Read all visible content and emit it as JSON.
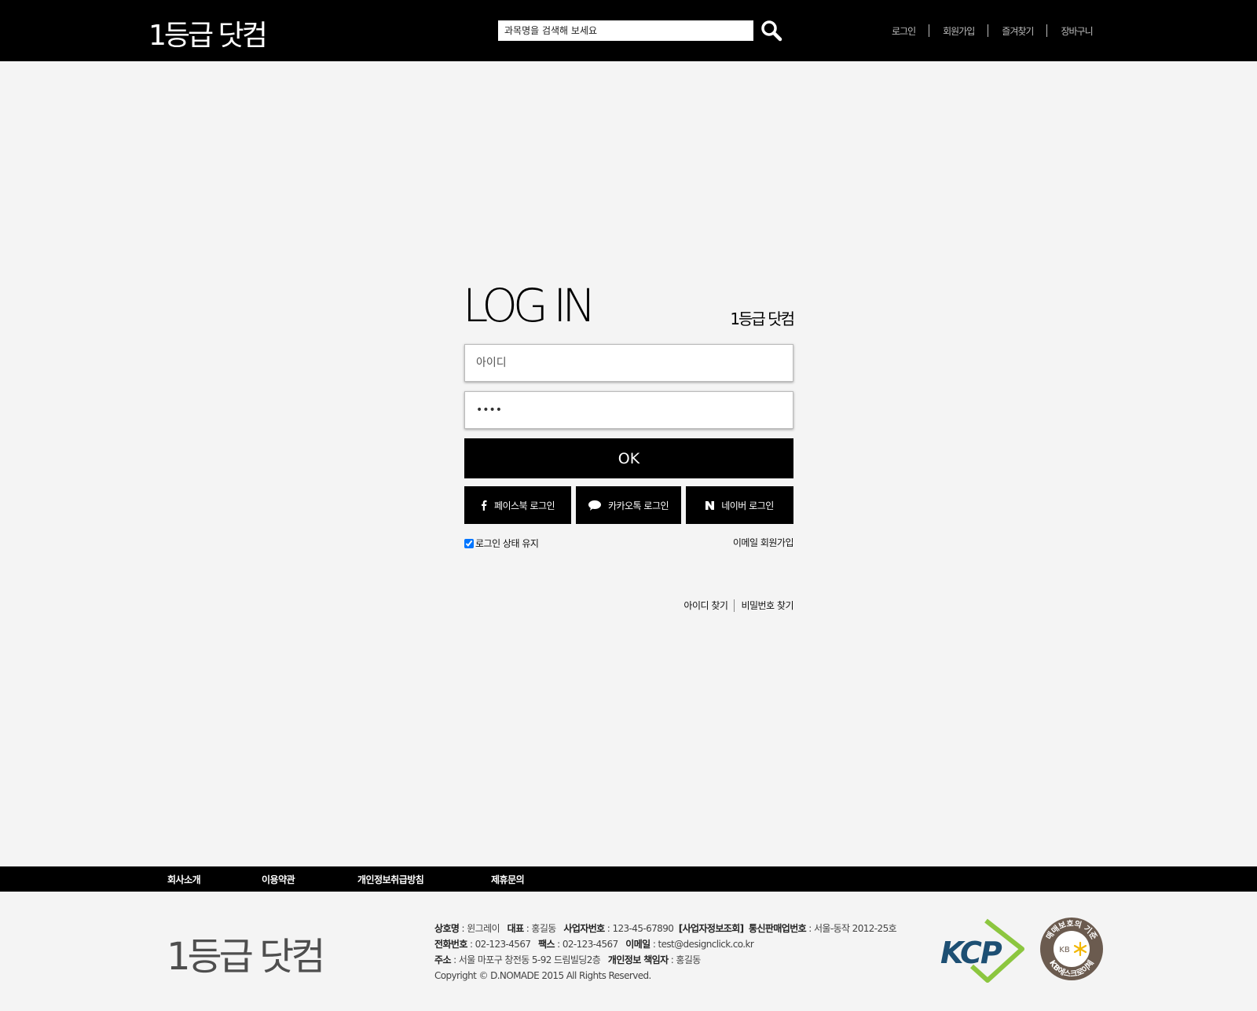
{
  "header": {
    "logo": "1등급 닷컴",
    "search_placeholder": "과목명을 검색해 보세요",
    "nav": [
      "로그인",
      "회원가입",
      "즐겨찾기",
      "장바구니"
    ]
  },
  "login": {
    "title": "LOG IN",
    "brand": "1등급 닷컴",
    "id_placeholder": "아이디",
    "pw_value": "••••",
    "ok_label": "OK",
    "facebook_label": "페이스북 로그인",
    "kakao_label": "카카오톡 로그인",
    "naver_label": "네이버 로그인",
    "keep_label": "로그인 상태 유지",
    "email_join": "이메일 회원가입",
    "find_id": "아이디 찾기",
    "find_pw": "비밀번호 찾기"
  },
  "footer": {
    "nav": [
      "회사소개",
      "이용약관",
      "개인정보취급방침",
      "제휴문의"
    ],
    "logo": "1등급 닷컴",
    "company_label": "상호명",
    "company": " : 윈그레이",
    "ceo_label": "대표",
    "ceo": " : 홍길동",
    "bizno_label": "사업자번호",
    "bizno": " : 123-45-67890",
    "bizinfo_label": "[사업자정보조회]",
    "mailorder_label": "통신판매업번호",
    "mailorder": " : 서울-동작 2012-25호",
    "phone_label": "전화번호",
    "phone": " : 02-123-4567",
    "fax_label": "팩스",
    "fax": " : 02-123-4567",
    "email_label": "이메일",
    "email": " : test@designclick.co.kr",
    "addr_label": "주소",
    "addr": " : 서울 마포구 창전동 5-92 드림빌딩2층",
    "privacy_label": "개인정보 책임자",
    "privacy": " : 홍길동",
    "copyright": "Copyright © D.NOMADE 2015 All Rights Reserved.",
    "kcp_text": "KCP",
    "kb_ring_top": "매매보호의 기준",
    "kb_ring_bottom": "KB에스크로이체",
    "kb_center": "KB"
  },
  "colors": {
    "header_bg": "#000000",
    "page_bg": "#f4f4f4",
    "kcp_blue": "#1d4f73",
    "kcp_green": "#8cc63f",
    "kb_brown": "#6b5b4f"
  }
}
